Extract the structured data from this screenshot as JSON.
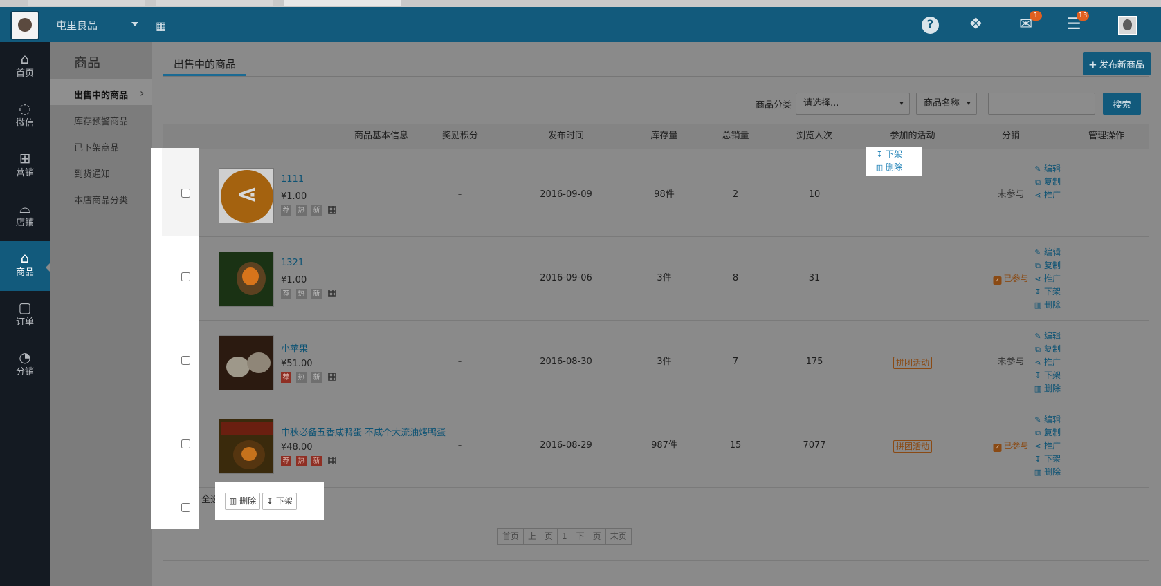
{
  "header": {
    "shop_name": "屯里良品",
    "help_label": "?",
    "messages_badge": "1",
    "tasks_badge": "13"
  },
  "left_nav": {
    "items": [
      {
        "label": "首页",
        "icon": "home-icon"
      },
      {
        "label": "微信",
        "icon": "wechat-icon"
      },
      {
        "label": "营销",
        "icon": "gift-icon"
      },
      {
        "label": "店铺",
        "icon": "store-icon"
      },
      {
        "label": "商品",
        "icon": "tag-icon",
        "active": true
      },
      {
        "label": "订单",
        "icon": "bag-icon"
      },
      {
        "label": "分销",
        "icon": "pie-icon"
      }
    ]
  },
  "sub_nav": {
    "title": "商品",
    "items": [
      {
        "label": "出售中的商品",
        "active": true
      },
      {
        "label": "库存预警商品"
      },
      {
        "label": "已下架商品"
      },
      {
        "label": "到货通知"
      },
      {
        "label": "本店商品分类"
      }
    ]
  },
  "main": {
    "tab": "出售中的商品",
    "publish_button": "✚ 发布新商品",
    "filter": {
      "category_label": "商品分类",
      "category_select": "请选择...",
      "field_select": "商品名称",
      "search_value": "",
      "search_button": "搜索"
    },
    "columns": [
      "商品基本信息",
      "奖励积分",
      "发布时间",
      "库存量",
      "总销量",
      "浏览人次",
      "参加的活动",
      "分销",
      "管理操作"
    ],
    "rows": [
      {
        "name": "1111",
        "price": "¥1.00",
        "tags": [
          "荐",
          "热",
          "新"
        ],
        "points": "–",
        "date": "2016-09-09",
        "stock": "98件",
        "sales": "2",
        "views": "10",
        "activity": "",
        "distribution": "未参与"
      },
      {
        "name": "1321",
        "price": "¥1.00",
        "tags": [
          "荐",
          "热",
          "新"
        ],
        "points": "–",
        "date": "2016-09-06",
        "stock": "3件",
        "sales": "8",
        "views": "31",
        "activity": "",
        "distribution": "已参与"
      },
      {
        "name": "小苹果",
        "price": "¥51.00",
        "tags": [
          "荐",
          "热",
          "新"
        ],
        "points": "–",
        "date": "2016-08-30",
        "stock": "3件",
        "sales": "7",
        "views": "175",
        "activity": "拼团活动",
        "distribution": "未参与"
      },
      {
        "name": "中秋必备五香咸鸭蛋 不咸个大流油烤鸭蛋",
        "price": "¥48.00",
        "tags": [
          "荐",
          "热",
          "新"
        ],
        "points": "–",
        "date": "2016-08-29",
        "stock": "987件",
        "sales": "15",
        "views": "7077",
        "activity": "拼团活动",
        "distribution": "已参与"
      }
    ],
    "actions": [
      "编辑",
      "复制",
      "推广",
      "下架",
      "删除"
    ],
    "select_all": "全选",
    "bulk": {
      "delete": "删除",
      "offshelf": "下架"
    },
    "pager": [
      "首页",
      "上一页",
      "1",
      "下一页",
      "末页"
    ]
  }
}
